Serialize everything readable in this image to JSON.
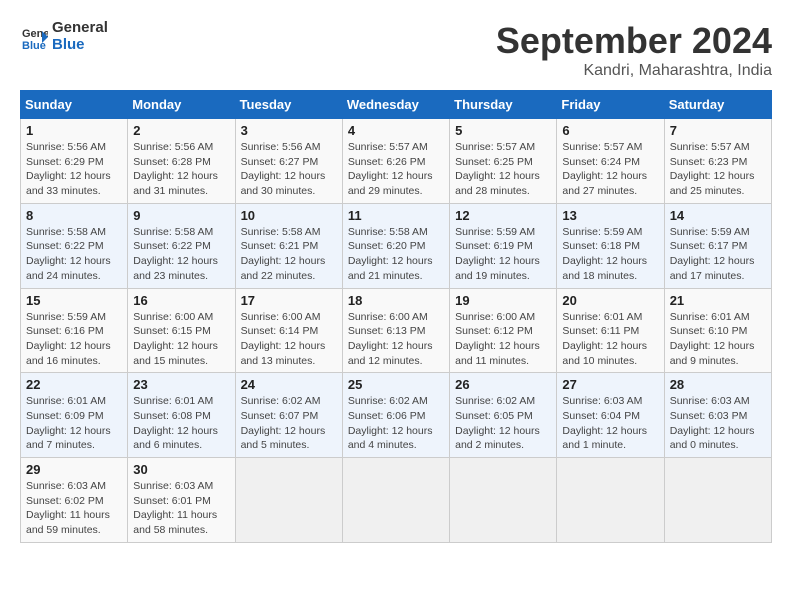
{
  "logo": {
    "line1": "General",
    "line2": "Blue"
  },
  "title": "September 2024",
  "subtitle": "Kandri, Maharashtra, India",
  "days_of_week": [
    "Sunday",
    "Monday",
    "Tuesday",
    "Wednesday",
    "Thursday",
    "Friday",
    "Saturday"
  ],
  "weeks": [
    [
      {
        "num": "1",
        "sunrise": "Sunrise: 5:56 AM",
        "sunset": "Sunset: 6:29 PM",
        "daylight": "Daylight: 12 hours and 33 minutes."
      },
      {
        "num": "2",
        "sunrise": "Sunrise: 5:56 AM",
        "sunset": "Sunset: 6:28 PM",
        "daylight": "Daylight: 12 hours and 31 minutes."
      },
      {
        "num": "3",
        "sunrise": "Sunrise: 5:56 AM",
        "sunset": "Sunset: 6:27 PM",
        "daylight": "Daylight: 12 hours and 30 minutes."
      },
      {
        "num": "4",
        "sunrise": "Sunrise: 5:57 AM",
        "sunset": "Sunset: 6:26 PM",
        "daylight": "Daylight: 12 hours and 29 minutes."
      },
      {
        "num": "5",
        "sunrise": "Sunrise: 5:57 AM",
        "sunset": "Sunset: 6:25 PM",
        "daylight": "Daylight: 12 hours and 28 minutes."
      },
      {
        "num": "6",
        "sunrise": "Sunrise: 5:57 AM",
        "sunset": "Sunset: 6:24 PM",
        "daylight": "Daylight: 12 hours and 27 minutes."
      },
      {
        "num": "7",
        "sunrise": "Sunrise: 5:57 AM",
        "sunset": "Sunset: 6:23 PM",
        "daylight": "Daylight: 12 hours and 25 minutes."
      }
    ],
    [
      {
        "num": "8",
        "sunrise": "Sunrise: 5:58 AM",
        "sunset": "Sunset: 6:22 PM",
        "daylight": "Daylight: 12 hours and 24 minutes."
      },
      {
        "num": "9",
        "sunrise": "Sunrise: 5:58 AM",
        "sunset": "Sunset: 6:22 PM",
        "daylight": "Daylight: 12 hours and 23 minutes."
      },
      {
        "num": "10",
        "sunrise": "Sunrise: 5:58 AM",
        "sunset": "Sunset: 6:21 PM",
        "daylight": "Daylight: 12 hours and 22 minutes."
      },
      {
        "num": "11",
        "sunrise": "Sunrise: 5:58 AM",
        "sunset": "Sunset: 6:20 PM",
        "daylight": "Daylight: 12 hours and 21 minutes."
      },
      {
        "num": "12",
        "sunrise": "Sunrise: 5:59 AM",
        "sunset": "Sunset: 6:19 PM",
        "daylight": "Daylight: 12 hours and 19 minutes."
      },
      {
        "num": "13",
        "sunrise": "Sunrise: 5:59 AM",
        "sunset": "Sunset: 6:18 PM",
        "daylight": "Daylight: 12 hours and 18 minutes."
      },
      {
        "num": "14",
        "sunrise": "Sunrise: 5:59 AM",
        "sunset": "Sunset: 6:17 PM",
        "daylight": "Daylight: 12 hours and 17 minutes."
      }
    ],
    [
      {
        "num": "15",
        "sunrise": "Sunrise: 5:59 AM",
        "sunset": "Sunset: 6:16 PM",
        "daylight": "Daylight: 12 hours and 16 minutes."
      },
      {
        "num": "16",
        "sunrise": "Sunrise: 6:00 AM",
        "sunset": "Sunset: 6:15 PM",
        "daylight": "Daylight: 12 hours and 15 minutes."
      },
      {
        "num": "17",
        "sunrise": "Sunrise: 6:00 AM",
        "sunset": "Sunset: 6:14 PM",
        "daylight": "Daylight: 12 hours and 13 minutes."
      },
      {
        "num": "18",
        "sunrise": "Sunrise: 6:00 AM",
        "sunset": "Sunset: 6:13 PM",
        "daylight": "Daylight: 12 hours and 12 minutes."
      },
      {
        "num": "19",
        "sunrise": "Sunrise: 6:00 AM",
        "sunset": "Sunset: 6:12 PM",
        "daylight": "Daylight: 12 hours and 11 minutes."
      },
      {
        "num": "20",
        "sunrise": "Sunrise: 6:01 AM",
        "sunset": "Sunset: 6:11 PM",
        "daylight": "Daylight: 12 hours and 10 minutes."
      },
      {
        "num": "21",
        "sunrise": "Sunrise: 6:01 AM",
        "sunset": "Sunset: 6:10 PM",
        "daylight": "Daylight: 12 hours and 9 minutes."
      }
    ],
    [
      {
        "num": "22",
        "sunrise": "Sunrise: 6:01 AM",
        "sunset": "Sunset: 6:09 PM",
        "daylight": "Daylight: 12 hours and 7 minutes."
      },
      {
        "num": "23",
        "sunrise": "Sunrise: 6:01 AM",
        "sunset": "Sunset: 6:08 PM",
        "daylight": "Daylight: 12 hours and 6 minutes."
      },
      {
        "num": "24",
        "sunrise": "Sunrise: 6:02 AM",
        "sunset": "Sunset: 6:07 PM",
        "daylight": "Daylight: 12 hours and 5 minutes."
      },
      {
        "num": "25",
        "sunrise": "Sunrise: 6:02 AM",
        "sunset": "Sunset: 6:06 PM",
        "daylight": "Daylight: 12 hours and 4 minutes."
      },
      {
        "num": "26",
        "sunrise": "Sunrise: 6:02 AM",
        "sunset": "Sunset: 6:05 PM",
        "daylight": "Daylight: 12 hours and 2 minutes."
      },
      {
        "num": "27",
        "sunrise": "Sunrise: 6:03 AM",
        "sunset": "Sunset: 6:04 PM",
        "daylight": "Daylight: 12 hours and 1 minute."
      },
      {
        "num": "28",
        "sunrise": "Sunrise: 6:03 AM",
        "sunset": "Sunset: 6:03 PM",
        "daylight": "Daylight: 12 hours and 0 minutes."
      }
    ],
    [
      {
        "num": "29",
        "sunrise": "Sunrise: 6:03 AM",
        "sunset": "Sunset: 6:02 PM",
        "daylight": "Daylight: 11 hours and 59 minutes."
      },
      {
        "num": "30",
        "sunrise": "Sunrise: 6:03 AM",
        "sunset": "Sunset: 6:01 PM",
        "daylight": "Daylight: 11 hours and 58 minutes."
      },
      null,
      null,
      null,
      null,
      null
    ]
  ]
}
